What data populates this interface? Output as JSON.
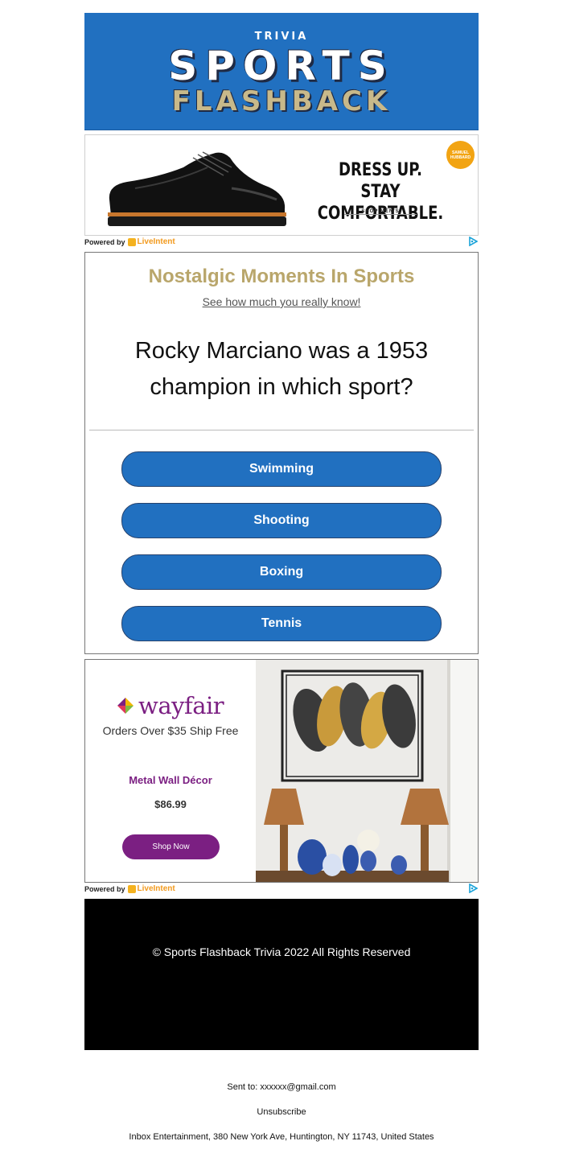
{
  "header": {
    "trivia": "TRIVIA",
    "sports": "SPORTS",
    "flashback": "FLASHBACK",
    "bg_color": "#2170c0"
  },
  "ad_top": {
    "headline_line1": "DRESS UP.",
    "headline_line2": "STAY COMFORTABLE.",
    "cta": "SHOP MEN'S",
    "brand_badge_line1": "SAMUEL",
    "brand_badge_line2": "HUBBARD",
    "powered_by": "Powered by",
    "provider": "LiveIntent",
    "product_icon": "dress-shoe-image"
  },
  "trivia": {
    "title": "Nostalgic Moments In Sports",
    "subtitle": "See how much you really know!",
    "question": "Rocky Marciano was a 1953 champion in which sport?",
    "answers": [
      "Swimming",
      "Shooting",
      "Boxing",
      "Tennis"
    ],
    "title_color": "#b9a66b",
    "button_color": "#2170c0"
  },
  "ad_wayfair": {
    "brand": "wayfair",
    "tagline": "Orders Over $35 Ship Free",
    "product": "Metal Wall Décor",
    "price": "$86.99",
    "cta": "Shop Now",
    "powered_by": "Powered by",
    "provider": "LiveIntent",
    "brand_color": "#7b1f82"
  },
  "footer": {
    "copyright": "© Sports Flashback Trivia 2022 All Rights Reserved",
    "sent_to": "Sent to: xxxxxx@gmail.com",
    "unsubscribe": "Unsubscribe",
    "address": "Inbox Entertainment, 380 New York Ave, Huntington, NY 11743, United States"
  }
}
